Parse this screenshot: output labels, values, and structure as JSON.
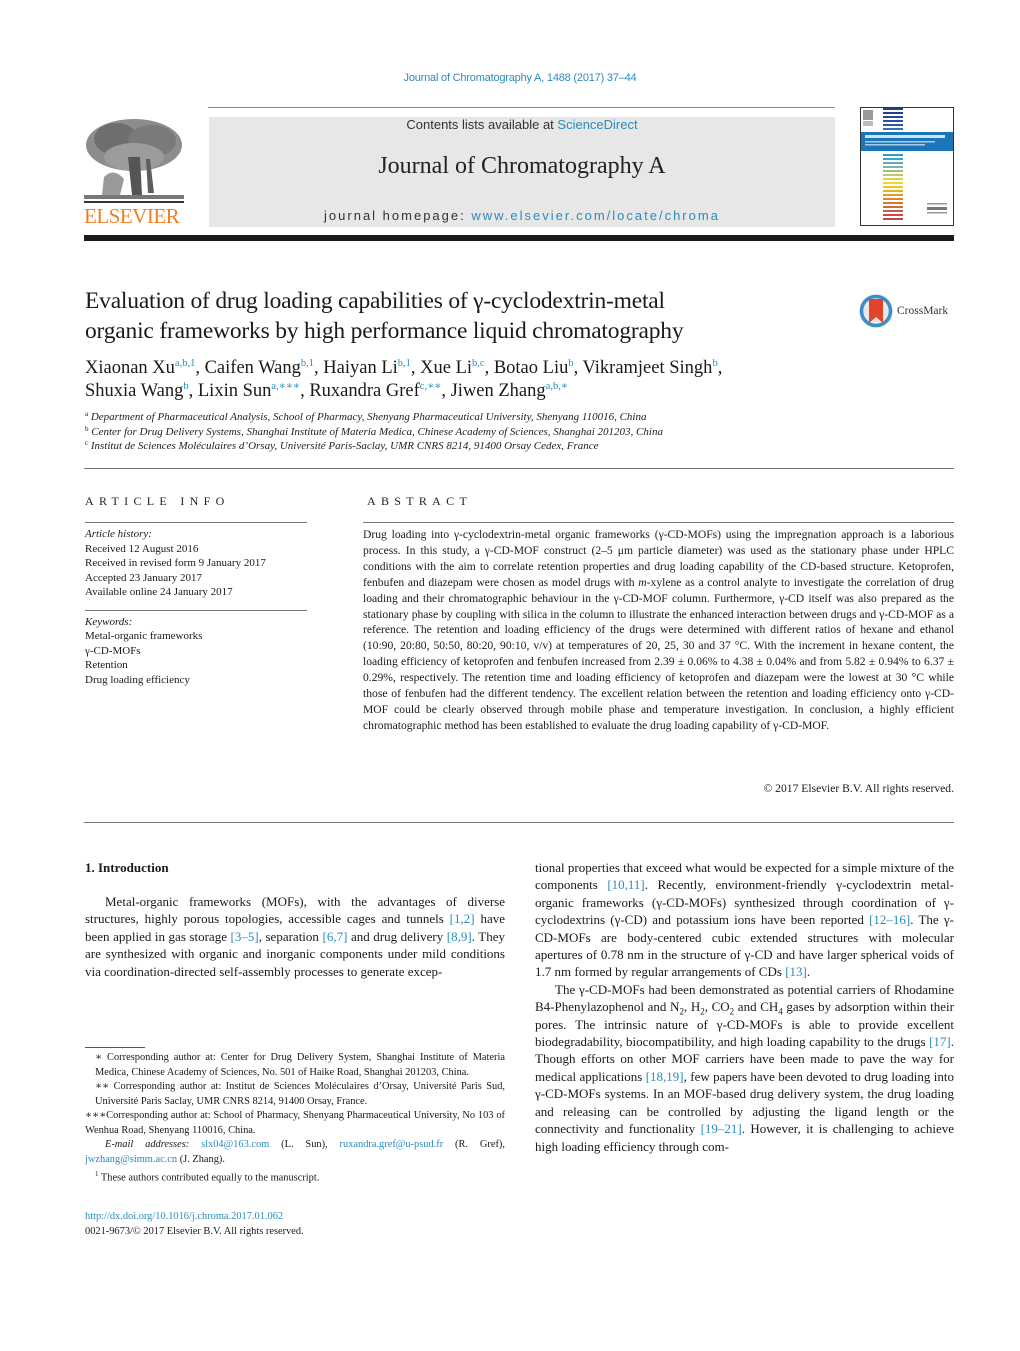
{
  "header": {
    "citation": "Journal of Chromatography A, 1488 (2017) 37–44",
    "contents_prefix": "Contents lists available at ",
    "contents_link": "ScienceDirect",
    "journal_name": "Journal of Chromatography A",
    "homepage_prefix": "journal homepage: ",
    "homepage_link": "www.elsevier.com/locate/chroma",
    "publisher_logo_text": "ELSEVIER",
    "publisher_logo_color": "#f07f1f",
    "crossmark_label": "CrossMark"
  },
  "title": {
    "line1": "Evaluation of drug loading capabilities of γ-cyclodextrin-metal",
    "line2": "organic frameworks by high performance liquid chromatography"
  },
  "authors": [
    {
      "name": "Xiaonan Xu",
      "sup": "a,b,1"
    },
    {
      "name": "Caifen Wang",
      "sup": "b,1"
    },
    {
      "name": "Haiyan Li",
      "sup": "b,1"
    },
    {
      "name": "Xue Li",
      "sup": "b,c"
    },
    {
      "name": "Botao Liu",
      "sup": "b"
    },
    {
      "name": "Vikramjeet Singh",
      "sup": "b"
    },
    {
      "name": "Shuxia Wang",
      "sup": "b"
    },
    {
      "name": "Lixin Sun",
      "sup": "a,∗∗∗"
    },
    {
      "name": "Ruxandra Gref",
      "sup": "c,∗∗"
    },
    {
      "name": "Jiwen Zhang",
      "sup": "a,b,∗"
    }
  ],
  "affiliations": [
    {
      "key": "a",
      "text": "Department of Pharmaceutical Analysis, School of Pharmacy, Shenyang Pharmaceutical University, Shenyang 110016, China"
    },
    {
      "key": "b",
      "text": "Center for Drug Delivery Systems, Shanghai Institute of Materia Medica, Chinese Academy of Sciences, Shanghai 201203, China"
    },
    {
      "key": "c",
      "text": "Institut de Sciences Moléculaires d’Orsay, Université Paris-Saclay, UMR CNRS 8214, 91400 Orsay Cedex, France"
    }
  ],
  "article_info": {
    "heading": "ARTICLE INFO",
    "history_label": "Article history:",
    "history": [
      "Received 12 August 2016",
      "Received in revised form 9 January 2017",
      "Accepted 23 January 2017",
      "Available online 24 January 2017"
    ],
    "keywords_label": "Keywords:",
    "keywords": [
      "Metal-organic frameworks",
      "γ-CD-MOFs",
      "Retention",
      "Drug loading efficiency"
    ]
  },
  "abstract": {
    "heading": "ABSTRACT",
    "text_part1": "Drug loading into γ-cyclodextrin-metal organic frameworks (γ-CD-MOFs) using the impregnation approach is a laborious process. In this study, a γ-CD-MOF construct (2–5 μm particle diameter) was used as the stationary phase under HPLC conditions with the aim to correlate retention properties and drug loading capability of the CD-based structure. Ketoprofen, fenbufen and diazepam were chosen as model drugs with ",
    "text_italic": "m",
    "text_part2": "-xylene as a control analyte to investigate the correlation of drug loading and their chromatographic behaviour in the γ-CD-MOF column. Furthermore, γ-CD itself was also prepared as the stationary phase by coupling with silica in the column to illustrate the enhanced interaction between drugs and γ-CD-MOF as a reference. The retention and loading efficiency of the drugs were determined with different ratios of hexane and ethanol (10:90, 20:80, 50:50, 80:20, 90:10, v/v) at temperatures of 20, 25, 30 and 37 °C. With the increment in hexane content, the loading efficiency of ketoprofen and fenbufen increased from 2.39 ± 0.06% to 4.38 ± 0.04% and from 5.82 ± 0.94% to 6.37 ± 0.29%, respectively. The retention time and loading efficiency of ketoprofen and diazepam were the lowest at 30 °C while those of fenbufen had the different tendency. The excellent relation between the retention and loading efficiency onto γ-CD-MOF could be clearly observed through mobile phase and temperature investigation. In conclusion, a highly efficient chromatographic method has been established to evaluate the drug loading capability of γ-CD-MOF.",
    "copyright": "© 2017 Elsevier B.V. All rights reserved."
  },
  "introduction": {
    "heading": "1.  Introduction",
    "p1": [
      {
        "t": "Metal-organic frameworks (MOFs), with the advantages of diverse structures, highly porous topologies, accessible cages and tunnels "
      },
      {
        "ref": "[1,2]"
      },
      {
        "t": " have been applied in gas storage "
      },
      {
        "ref": "[3–5]"
      },
      {
        "t": ", separation "
      },
      {
        "ref": "[6,7]"
      },
      {
        "t": " and drug delivery "
      },
      {
        "ref": "[8,9]"
      },
      {
        "t": ". They are synthesized with organic and inorganic components under mild conditions via coordination-directed self-assembly processes to generate excep-"
      }
    ],
    "p1_cont": [
      {
        "t": "tional properties that exceed what would be expected for a simple mixture of the components "
      },
      {
        "ref": "[10,11]"
      },
      {
        "t": ". Recently, environment-friendly γ-cyclodextrin metal-organic frameworks (γ-CD-MOFs) synthesized through coordination of γ-cyclodextrins (γ-CD) and potassium ions have been reported "
      },
      {
        "ref": "[12–16]"
      },
      {
        "t": ". The γ-CD-MOFs are body-centered cubic extended structures with molecular apertures of 0.78 nm in the structure of γ-CD and have larger spherical voids of 1.7 nm formed by regular arrangements of CDs "
      },
      {
        "ref": "[13]"
      },
      {
        "t": "."
      }
    ],
    "p2": [
      {
        "t": "The γ-CD-MOFs had been demonstrated as potential carriers of Rhodamine B4-Phenylazophenol and N"
      },
      {
        "sub": "2"
      },
      {
        "t": ", H"
      },
      {
        "sub": "2"
      },
      {
        "t": ", CO"
      },
      {
        "sub": "2"
      },
      {
        "t": " and CH"
      },
      {
        "sub": "4"
      },
      {
        "t": " gases by adsorption within their pores. The intrinsic nature of γ-CD-MOFs is able to provide excellent biodegradability, biocompatibility, and high loading capability to the drugs "
      },
      {
        "ref": "[17]"
      },
      {
        "t": ". Though efforts on other MOF carriers have been made to pave the way for medical applications "
      },
      {
        "ref": "[18,19]"
      },
      {
        "t": ", few papers have been devoted to drug loading into γ-CD-MOFs systems. In an MOF-based drug delivery system, the drug loading and releasing can be controlled by adjusting the ligand length or the connectivity and functionality "
      },
      {
        "ref": "[19–21]"
      },
      {
        "t": ". However, it is challenging to achieve high loading efficiency through com-"
      }
    ]
  },
  "footnotes": {
    "fn1": "∗  Corresponding author at: Center for Drug Delivery System, Shanghai Institute of Materia Medica, Chinese Academy of Sciences, No. 501 of Haike Road, Shanghai 201203, China.",
    "fn2": "∗∗  Corresponding author at: Institut de Sciences Moléculaires d’Orsay, Université Paris Sud, Université Paris Saclay, UMR CNRS 8214, 91400 Orsay, France.",
    "fn3": "∗∗∗Corresponding author at: School of Pharmacy, Shenyang Pharmaceutical University, No 103 of Wenhua Road, Shenyang 110016, China.",
    "email_label": "E-mail addresses:",
    "emails": [
      {
        "addr": "slx04@163.com",
        "who": " (L. Sun), "
      },
      {
        "addr": "ruxandra.gref@u-psud.fr",
        "who": " (R. Gref), "
      },
      {
        "addr": "jwzhang@simm.ac.cn",
        "who": " (J. Zhang)."
      }
    ],
    "fn_equal_mark": "1",
    "fn_equal": "These authors contributed equally to the manuscript.",
    "doi": "http://dx.doi.org/10.1016/j.chroma.2017.01.062",
    "issn": "0021-9673/© 2017 Elsevier B.V. All rights reserved."
  },
  "colors": {
    "link": "#2a8cbd",
    "publisher_orange": "#f07f1f",
    "header_box": "#e7e7e7"
  }
}
